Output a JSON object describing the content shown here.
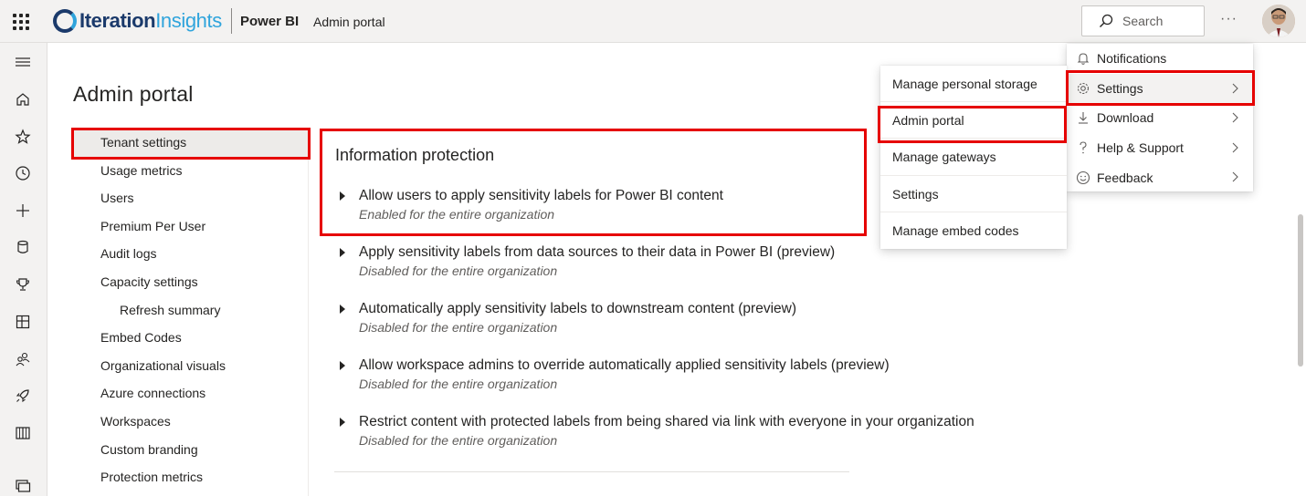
{
  "header": {
    "logo_iteration": "Iteration",
    "logo_insights": "Insights",
    "app_name": "Power BI",
    "page_crumb": "Admin portal",
    "search_placeholder": "Search",
    "more_label": "···"
  },
  "rail": {
    "icons": [
      "hamburger-icon",
      "home-icon",
      "star-icon",
      "clock-icon",
      "plus-icon",
      "cylinder-icon",
      "trophy-icon",
      "apps-icon",
      "people-icon",
      "rocket-icon",
      "book-icon",
      "monitor-icon"
    ]
  },
  "admin": {
    "title": "Admin portal",
    "nav": [
      {
        "label": "Tenant settings"
      },
      {
        "label": "Usage metrics"
      },
      {
        "label": "Users"
      },
      {
        "label": "Premium Per User"
      },
      {
        "label": "Audit logs"
      },
      {
        "label": "Capacity settings"
      },
      {
        "label": "Refresh summary"
      },
      {
        "label": "Embed Codes"
      },
      {
        "label": "Organizational visuals"
      },
      {
        "label": "Azure connections"
      },
      {
        "label": "Workspaces"
      },
      {
        "label": "Custom branding"
      },
      {
        "label": "Protection metrics"
      }
    ]
  },
  "content": {
    "section_title": "Information protection",
    "settings": [
      {
        "title": "Allow users to apply sensitivity labels for Power BI content",
        "status": "Enabled for the entire organization"
      },
      {
        "title": "Apply sensitivity labels from data sources to their data in Power BI (preview)",
        "status": "Disabled for the entire organization"
      },
      {
        "title": "Automatically apply sensitivity labels to downstream content (preview)",
        "status": "Disabled for the entire organization"
      },
      {
        "title": "Allow workspace admins to override automatically applied sensitivity labels (preview)",
        "status": "Disabled for the entire organization"
      },
      {
        "title": "Restrict content with protected labels from being shared via link with everyone in your organization",
        "status": "Disabled for the entire organization"
      }
    ]
  },
  "settings_menu": {
    "items": [
      {
        "label": "Notifications",
        "icon": "bell-icon"
      },
      {
        "label": "Settings",
        "icon": "gear-icon"
      },
      {
        "label": "Download",
        "icon": "download-icon"
      },
      {
        "label": "Help & Support",
        "icon": "question-icon"
      },
      {
        "label": "Feedback",
        "icon": "smiley-icon"
      }
    ]
  },
  "settings_submenu": {
    "items": [
      {
        "label": "Manage personal storage"
      },
      {
        "label": "Admin portal"
      },
      {
        "label": "Manage gateways"
      },
      {
        "label": "Settings"
      },
      {
        "label": "Manage embed codes"
      }
    ]
  },
  "colors": {
    "highlight": "#e60000",
    "logo_dark": "#1b3a6b",
    "logo_light": "#2fa4dc"
  }
}
